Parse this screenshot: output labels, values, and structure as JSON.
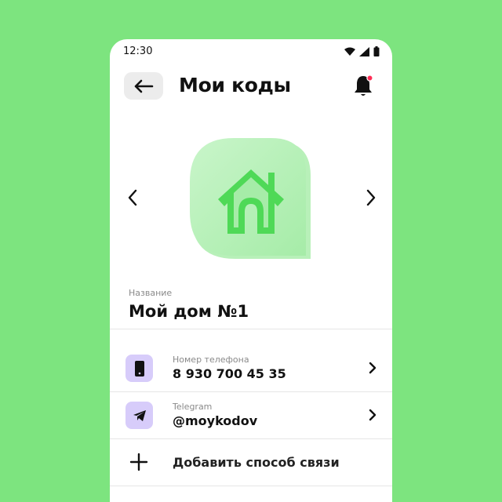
{
  "status_bar": {
    "time": "12:30",
    "icons": [
      "wifi-icon",
      "signal-icon",
      "battery-icon"
    ]
  },
  "header": {
    "back_icon": "arrow-left-icon",
    "title": "Мои коды",
    "notification_icon": "bell-icon",
    "notification_badge_color": "#ff2d55"
  },
  "carousel": {
    "prev_icon": "chevron-left-icon",
    "next_icon": "chevron-right-icon",
    "item_icon": "house-icon",
    "item_color": "#7de47f"
  },
  "code": {
    "name_label": "Название",
    "name_value": "Мой дом №1"
  },
  "contacts": [
    {
      "icon": "phone-icon",
      "label": "Номер телефона",
      "value": "8 930 700 45 35"
    },
    {
      "icon": "telegram-icon",
      "label": "Telegram",
      "value": "@moykodov"
    }
  ],
  "add_contact": {
    "icon": "plus-icon",
    "label": "Добавить способ связи"
  },
  "colors": {
    "background": "#7de47f",
    "contact_icon_bg": "#d7ccfa"
  }
}
